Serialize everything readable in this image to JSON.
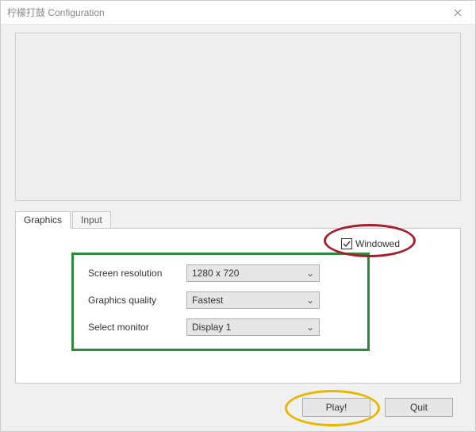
{
  "window": {
    "title": "柠檬打鼓 Configuration"
  },
  "tabs": {
    "graphics": "Graphics",
    "input": "Input"
  },
  "graphics": {
    "resolution_label": "Screen resolution",
    "resolution_value": "1280 x 720",
    "quality_label": "Graphics quality",
    "quality_value": "Fastest",
    "monitor_label": "Select monitor",
    "monitor_value": "Display 1",
    "windowed_label": "Windowed",
    "windowed_checked": true
  },
  "buttons": {
    "play": "Play!",
    "quit": "Quit"
  }
}
